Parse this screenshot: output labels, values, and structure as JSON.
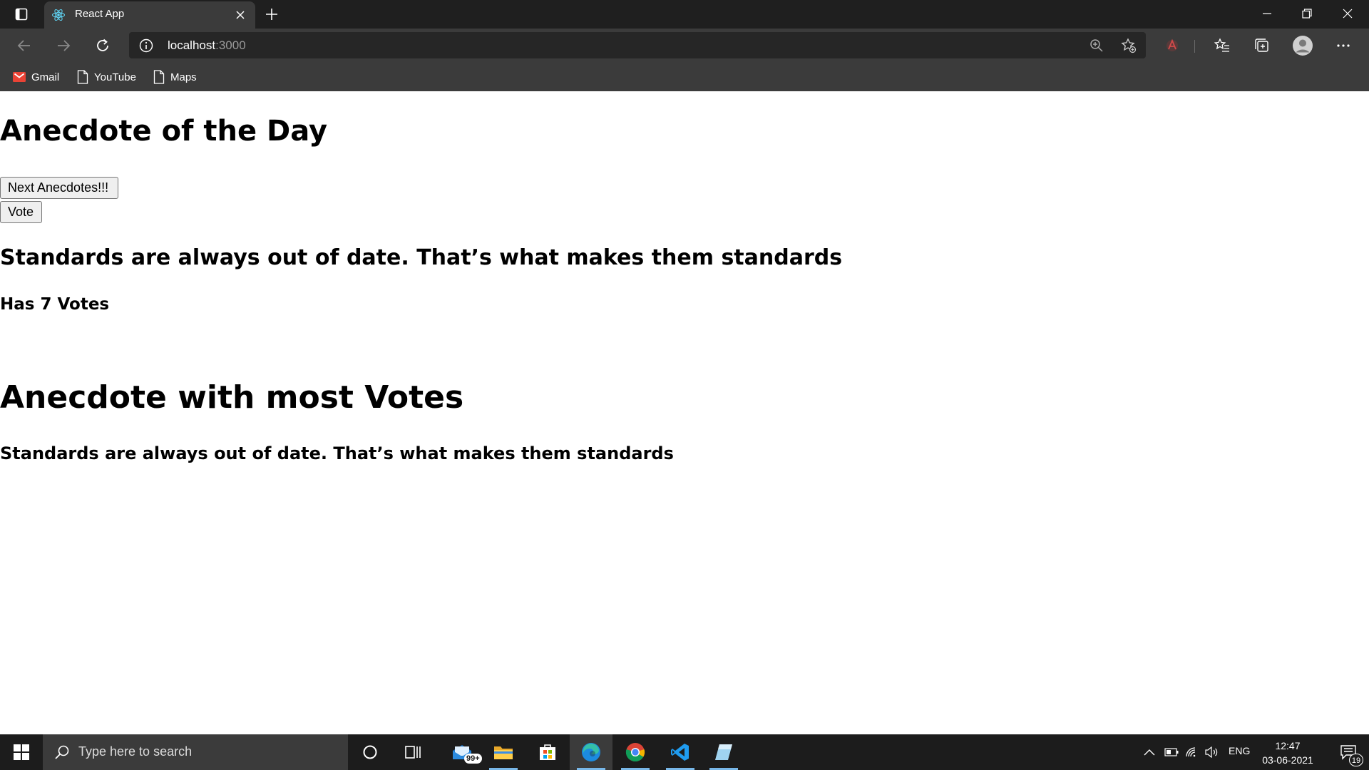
{
  "browser": {
    "tab": {
      "title": "React App",
      "favicon": "react-icon"
    },
    "address": {
      "host": "localhost",
      "port": ":3000"
    },
    "bookmarks": [
      {
        "label": "Gmail",
        "icon": "gmail-icon"
      },
      {
        "label": "YouTube",
        "icon": "page-icon"
      },
      {
        "label": "Maps",
        "icon": "page-icon"
      }
    ]
  },
  "page": {
    "heading": "Anecdote of the Day",
    "next_button": "Next Anecdotes!!!",
    "vote_button": "Vote",
    "anecdote": "Standards are always out of date. That’s what makes them standards",
    "votes_text": "Has 7 Votes",
    "most_votes_heading": "Anecdote with most Votes",
    "most_votes_anecdote": "Standards are always out of date. That’s what makes them standards"
  },
  "taskbar": {
    "search_placeholder": "Type here to search",
    "mail_badge": "99+",
    "language": "ENG",
    "time": "12:47",
    "date": "03-06-2021",
    "notification_count": "19"
  },
  "colors": {
    "titlebar": "#1f1f1f",
    "toolbar": "#3b3b3b",
    "taskbar": "#1c1c1c",
    "accent": "#78b7e8"
  }
}
